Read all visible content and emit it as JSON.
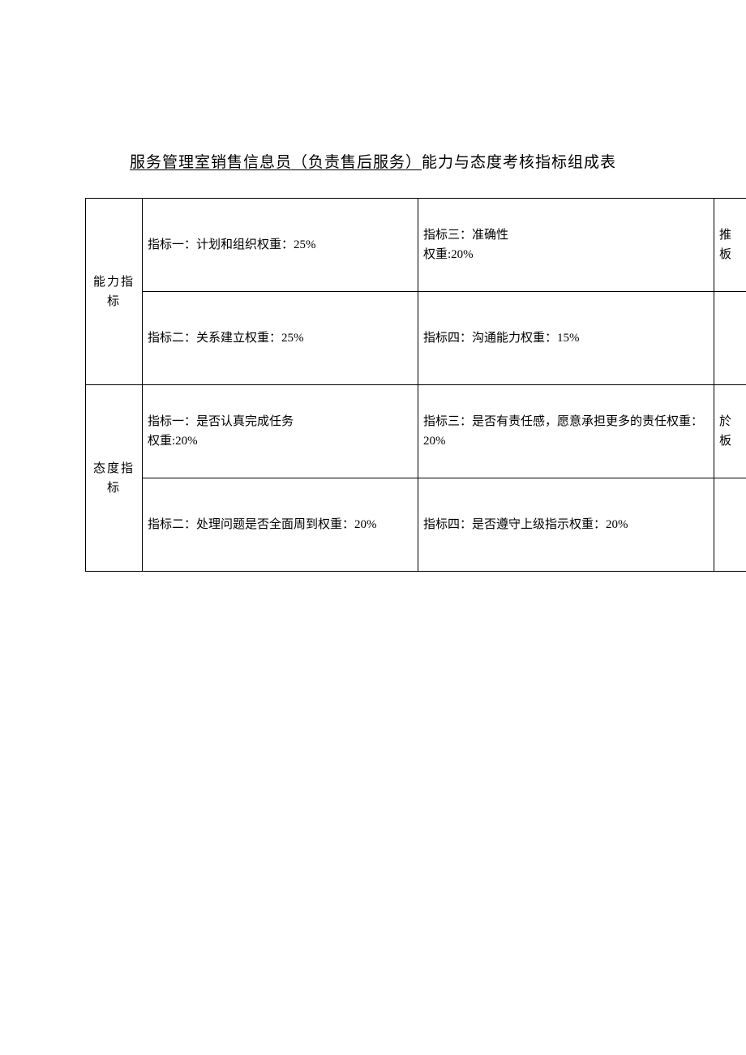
{
  "title": {
    "underlined": "服务管理室销售信息员（负责售后服务）",
    "rest": "能力与态度考核指标组成表"
  },
  "sections": [
    {
      "header": "能力指标",
      "rows": [
        {
          "colA": "指标一：计划和组织权重：25%",
          "colB_line1": "指标三：准确性",
          "colB_line2": "权重:20%",
          "colC_line1": "推",
          "colC_line2": "板"
        },
        {
          "colA": "指标二：关系建立权重：25%",
          "colB": "指标四：沟通能力权重：15%",
          "colC": ""
        }
      ]
    },
    {
      "header": "态度指标",
      "rows": [
        {
          "colA_line1": "指标一：是否认真完成任务",
          "colA_line2": "权重:20%",
          "colB": "指标三：是否有责任感，愿意承担更多的责任权重：20%",
          "colC_line1": "於",
          "colC_line2": "板"
        },
        {
          "colA": "指标二：处理问题是否全面周到权重：20%",
          "colB": "指标四：是否遵守上级指示权重：20%",
          "colC": ""
        }
      ]
    }
  ]
}
